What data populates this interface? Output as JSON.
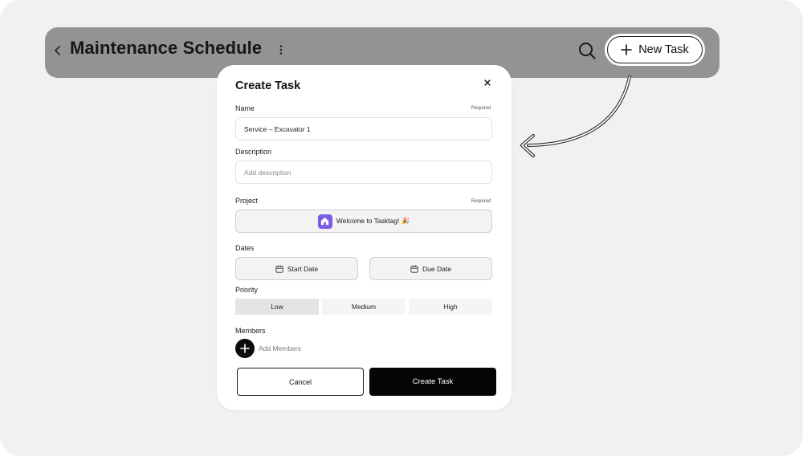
{
  "header": {
    "title": "Maintenance Schedule",
    "new_task_label": "New Task"
  },
  "modal": {
    "title": "Create Task",
    "name": {
      "label": "Name",
      "required": "Required",
      "value": "Service – Excavator 1"
    },
    "description": {
      "label": "Description",
      "placeholder": "Add description"
    },
    "project": {
      "label": "Project",
      "required": "Required",
      "selected": "Welcome to Tasktag! 🎉"
    },
    "dates": {
      "label": "Dates",
      "start_label": "Start Date",
      "due_label": "Due Date"
    },
    "priority": {
      "label": "Priority",
      "options": [
        "Low",
        "Medium",
        "High"
      ],
      "selected": "Low"
    },
    "members": {
      "label": "Members",
      "add_label": "Add Members"
    },
    "cancel_label": "Cancel",
    "create_label": "Create Task"
  },
  "colors": {
    "background": "#f1f1f1",
    "header_bar": "#939393",
    "project_accent": "#7b5ce6",
    "primary_button": "#050505"
  },
  "icons": [
    "chevron-left-icon",
    "more-vertical-icon",
    "search-icon",
    "plus-icon",
    "close-icon",
    "home-icon",
    "calendar-icon",
    "curved-arrow-icon"
  ]
}
